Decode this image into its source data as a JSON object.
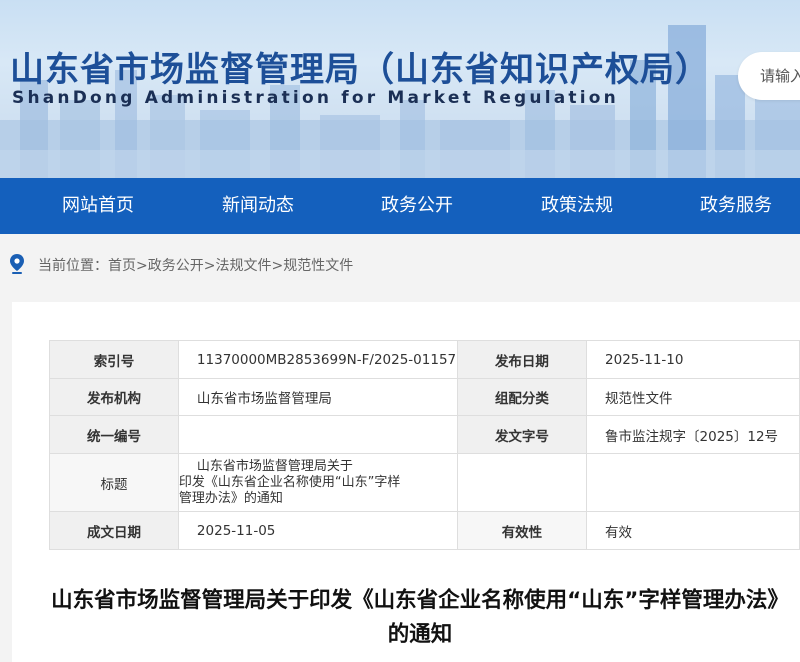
{
  "header": {
    "title": "山东省市场监督管理局（山东省知识产权局）",
    "subtitle": "ShanDong Administration for Market Regulation",
    "search_placeholder": "请输入"
  },
  "nav": {
    "items": [
      {
        "label": "网站首页"
      },
      {
        "label": "新闻动态"
      },
      {
        "label": "政务公开"
      },
      {
        "label": "政策法规"
      },
      {
        "label": "政务服务"
      }
    ]
  },
  "breadcrumb": {
    "prefix": "当前位置：",
    "items": [
      "首页",
      "政务公开",
      "法规文件",
      "规范性文件"
    ],
    "separator": ">"
  },
  "meta": {
    "index_no_label": "索引号",
    "index_no": "11370000MB2853699N-F/2025-01157",
    "publish_date_label": "发布日期",
    "publish_date": "2025-11-10",
    "publisher_label": "发布机构",
    "publisher": "山东省市场监督管理局",
    "category_label": "组配分类",
    "category": "规范性文件",
    "unified_no_label": "统一编号",
    "unified_no": "",
    "doc_no_label": "发文字号",
    "doc_no": "鲁市监注规字〔2025〕12号",
    "title_label": "标题",
    "title_lines": [
      "山东省市场监督管理局关于",
      "印发《山东省企业名称使用“山东”字样",
      "管理办法》的通知"
    ],
    "created_date_label": "成文日期",
    "created_date": "2025-11-05",
    "validity_label": "有效性",
    "validity": "有效"
  },
  "document": {
    "title": "山东省市场监督管理局关于印发《山东省企业名称使用“山东”字样管理办法》的通知"
  },
  "colors": {
    "nav_bg": "#1460bd",
    "title_blue": "#1d4f98",
    "pin_blue": "#1a5fb4"
  },
  "icons": {
    "location": "location-pin-icon"
  }
}
